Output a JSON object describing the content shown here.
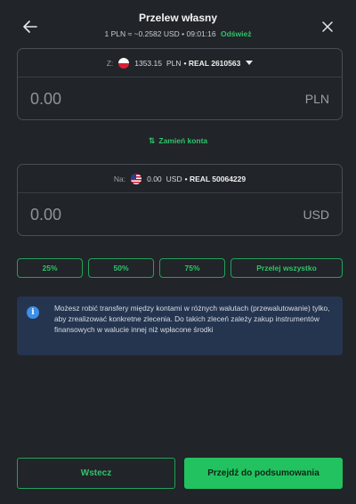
{
  "header": {
    "title": "Przelew własny",
    "rate_text": "1 PLN ≈ ~0.2582 USD • 09:01:16",
    "refresh_label": "Odśwież"
  },
  "from_account": {
    "label": "Z:",
    "balance": "1353.15",
    "currency_code": "PLN",
    "account_name": "• REAL 2610563",
    "amount_placeholder": "0.00",
    "currency": "PLN"
  },
  "swap_label": "Zamień konta",
  "to_account": {
    "label": "Na:",
    "balance": "0.00",
    "currency_code": "USD",
    "account_name": "• REAL 50064229",
    "amount_placeholder": "0.00",
    "currency": "USD"
  },
  "quick_amounts": {
    "p25": "25%",
    "p50": "50%",
    "p75": "75%",
    "all": "Przelej wszystko"
  },
  "info": {
    "text": "Możesz robić transfery między kontami w różnych walutach (przewalutowanie) tylko, aby zrealizować konkretne zlecenia. Do takich zleceń zależy zakup instrumentów finansowych w walucie innej niż wpłacone środki"
  },
  "footer": {
    "back_label": "Wstecz",
    "next_label": "Przejdź do podsumowania"
  },
  "colors": {
    "accent": "#2fc46b",
    "background": "#212428",
    "info_bg": "#253550"
  }
}
